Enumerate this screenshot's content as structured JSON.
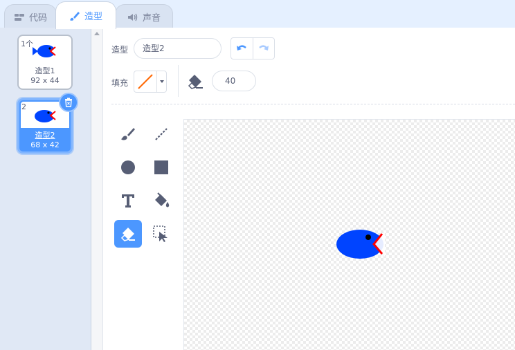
{
  "tabs": [
    {
      "label": "代码",
      "icon": "code-icon",
      "active": false
    },
    {
      "label": "造型",
      "icon": "brush-icon",
      "active": true
    },
    {
      "label": "声音",
      "icon": "sound-icon",
      "active": false
    }
  ],
  "costumes": [
    {
      "number": "1个",
      "name": "造型1",
      "size": "92 x 44",
      "selected": false
    },
    {
      "number": "2",
      "name": "造型2",
      "size": "68 x 42",
      "selected": true
    }
  ],
  "editor": {
    "costume_label": "造型",
    "costume_name": "造型2",
    "fill_label": "填充",
    "fill_color": "#ff6600",
    "eraser_size": "40"
  },
  "tools": [
    {
      "name": "brush",
      "active": false
    },
    {
      "name": "line",
      "active": false
    },
    {
      "name": "circle",
      "active": false
    },
    {
      "name": "rectangle",
      "active": false
    },
    {
      "name": "text",
      "active": false
    },
    {
      "name": "fill",
      "active": false
    },
    {
      "name": "eraser",
      "active": true
    },
    {
      "name": "select",
      "active": false
    }
  ],
  "colors": {
    "accent": "#4c97ff",
    "fish_body": "#0044ff",
    "fish_mouth": "#ff0000"
  }
}
